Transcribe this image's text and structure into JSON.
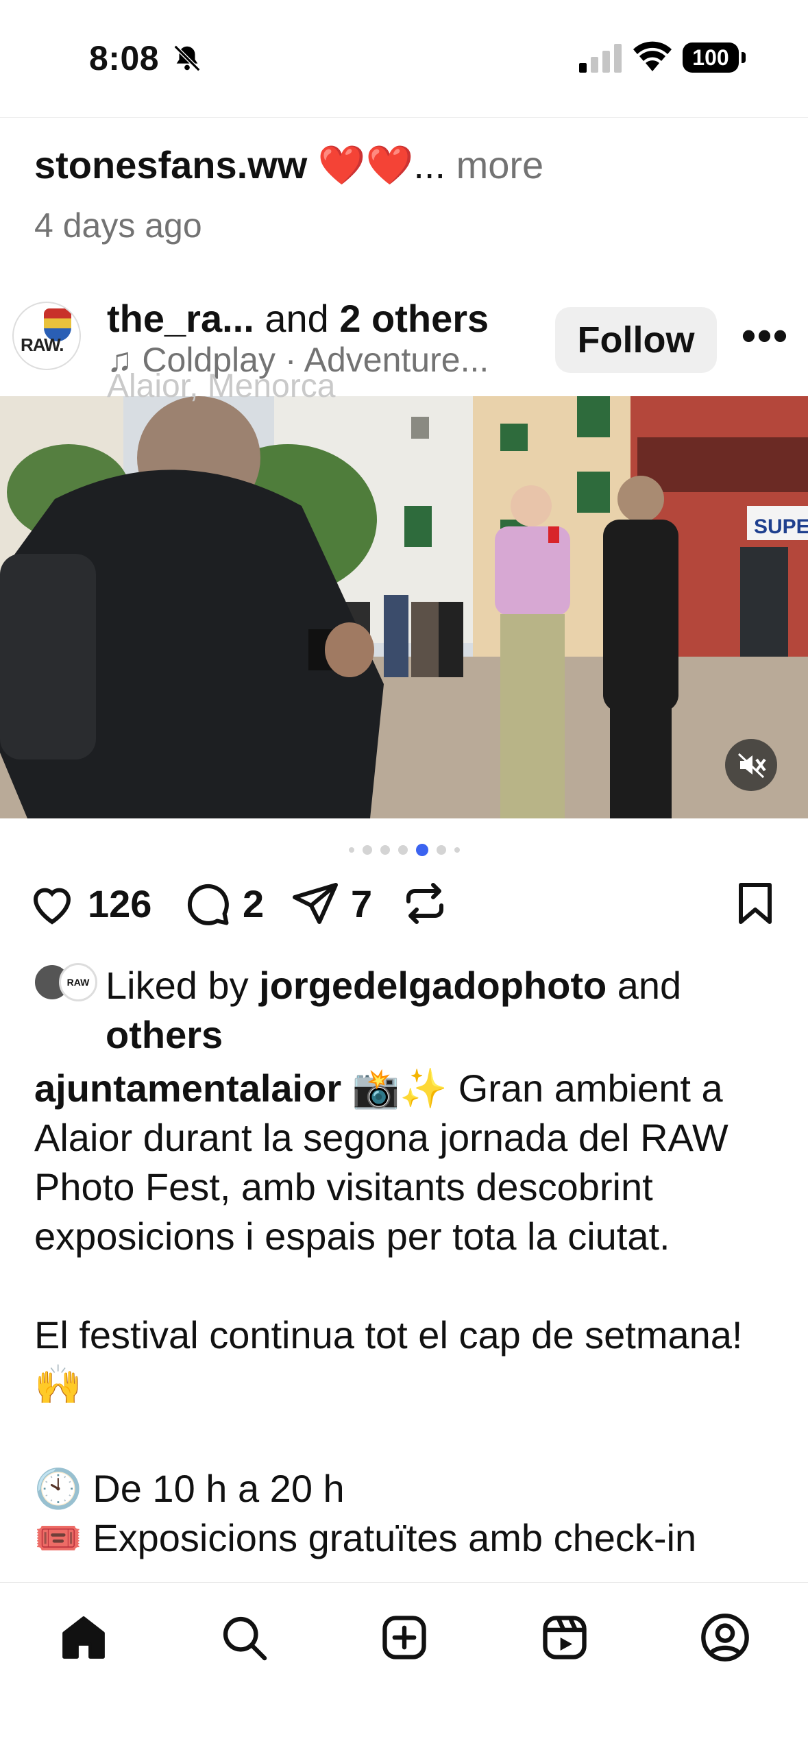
{
  "status_bar": {
    "time": "8:08",
    "battery": "100"
  },
  "previous_post": {
    "others_fragment": "others",
    "username": "stonesfans.ww",
    "emojis": "❤️❤️",
    "ellipsis": "...",
    "more_label": "more",
    "timestamp": "4 days ago"
  },
  "post": {
    "header": {
      "username_short": "the_ra...",
      "and_text": "and",
      "others_text": "2 others",
      "audio_icon": "♫",
      "audio": "Coldplay · Adventure...",
      "location": "Alaior, Menorca",
      "follow_label": "Follow",
      "more_icon": "•••"
    },
    "carousel": {
      "count": 7,
      "active_index": 4
    },
    "actions": {
      "likes": "126",
      "comments": "2",
      "shares": "7"
    },
    "liked_by": {
      "prefix": "Liked by",
      "user": "jorgedelgadophoto",
      "and_text": "and",
      "others": "others"
    },
    "caption": {
      "username": "ajuntamentalaior",
      "emoji_intro": "📸✨",
      "text1": "Gran ambient a Alaior durant la segona jornada del RAW Photo Fest, amb visitants descobrint exposicions i espais per tota la ciutat.",
      "text2": "El festival continua tot el cap de setmana! 🙌",
      "hours": "🕙 De 10 h a 20 h",
      "entry": "🎟️ Exposicions gratuïtes amb check-in"
    }
  },
  "bottom_nav": {
    "items": [
      "home-icon",
      "search-icon",
      "create-icon",
      "reels-icon",
      "profile-icon"
    ]
  }
}
